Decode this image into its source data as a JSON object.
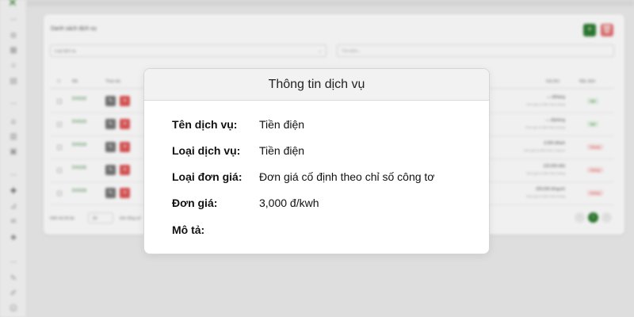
{
  "modal": {
    "title": "Thông tin dịch vụ",
    "fields": [
      {
        "label": "Tên dịch vụ:",
        "value": "Tiền điện"
      },
      {
        "label": "Loại dịch vụ:",
        "value": "Tiền điện"
      },
      {
        "label": "Loại đơn giá:",
        "value": "Đơn giá cố định theo chỉ số công tơ"
      },
      {
        "label": "Đơn giá:",
        "value": "3,000 đ/kwh"
      },
      {
        "label": "Mô tả:",
        "value": ""
      }
    ]
  },
  "background": {
    "card_title": "Danh sách dịch vụ",
    "add_label": "+",
    "delete_label": "🗑",
    "filter_placeholder": "Loại dịch vụ",
    "search_placeholder": "Tìm kiếm...",
    "headers": {
      "code": "Mã",
      "actions": "Thao tác",
      "price": "Giá tiền",
      "status": "Mặc định"
    },
    "rows": [
      {
        "code": "DV0102",
        "price": "— đ/tháng",
        "price_sub": "Đơn giá cố định theo tháng",
        "badge": "Bật",
        "badge_on": true
      },
      {
        "code": "DV0103",
        "price": "— đ/phòng",
        "price_sub": "Đơn giá cố định theo phòng",
        "badge": "Bật",
        "badge_on": true
      },
      {
        "code": "DV0104",
        "price": "3,000 đ/kwh",
        "price_sub": "Đơn giá cố định theo công tơ",
        "badge": "Không",
        "badge_on": false
      },
      {
        "code": "DV0105",
        "price": "120,000 đ/tủ",
        "price_sub": "Đơn giá cố định theo tháng",
        "badge": "Không",
        "badge_on": false
      },
      {
        "code": "DV0106",
        "price": "200,000 đ/người",
        "price_sub": "Đơn giá cố định theo tháng",
        "badge": "Không",
        "badge_on": false
      }
    ],
    "footer": {
      "show_label": "Hiển thị tối đa",
      "per_page": "30",
      "total_label": "trên tổng số",
      "page": "1"
    }
  },
  "colors": {
    "accent": "#2e7d32",
    "danger": "#e05555"
  }
}
